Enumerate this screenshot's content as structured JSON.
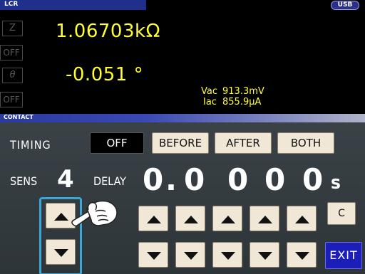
{
  "header": {
    "title": "LCR",
    "usb_badge": "USB"
  },
  "measurement": {
    "param1_label": "Z",
    "param1_value": "1.06703kΩ",
    "param2_label": "OFF",
    "param3_label": "θ",
    "param3_value": "-0.051 °",
    "param4_label": "OFF",
    "vac_label": "Vac",
    "vac_value": "913.3mV",
    "iac_label": "Iac",
    "iac_value": "855.9μA"
  },
  "contact": {
    "title": "CONTACT",
    "timing_label": "TIMING",
    "timing_options": [
      "OFF",
      "BEFORE",
      "AFTER",
      "BOTH"
    ],
    "timing_selected": "OFF",
    "sens_label": "SENS",
    "sens_value": "4",
    "delay_label": "DELAY",
    "delay_digits": [
      "0",
      ".",
      "0",
      "0",
      "0",
      "0"
    ],
    "delay_unit": "s",
    "clear_label": "C",
    "exit_label": "EXIT"
  },
  "icons": {
    "up": "up-arrow-icon",
    "down": "down-arrow-icon",
    "pointer": "pointing-hand-icon"
  },
  "colors": {
    "measurement_text": "#ffff33",
    "button_face": "#f0e7d6",
    "exit_button": "#1b1fb7",
    "selection_frame": "#3aa6d8"
  }
}
